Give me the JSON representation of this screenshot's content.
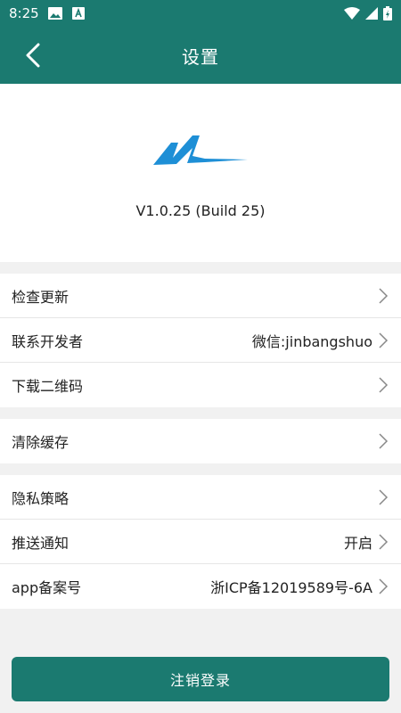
{
  "status_bar": {
    "time": "8:25"
  },
  "app_bar": {
    "title": "设置"
  },
  "about": {
    "version": "V1.0.25 (Build 25)"
  },
  "groups": [
    {
      "items": [
        {
          "label": "检查更新",
          "value": ""
        },
        {
          "label": "联系开发者",
          "value": "微信:jinbangshuo"
        },
        {
          "label": "下载二维码",
          "value": ""
        }
      ]
    },
    {
      "items": [
        {
          "label": "清除缓存",
          "value": ""
        }
      ]
    },
    {
      "items": [
        {
          "label": "隐私策略",
          "value": ""
        },
        {
          "label": "推送通知",
          "value": "开启"
        },
        {
          "label": "app备案号",
          "value": "浙ICP备12019589号-6A"
        }
      ]
    }
  ],
  "logout_label": "注销登录",
  "colors": {
    "primary": "#1b7a70",
    "logo_blue": "#1e8fd6",
    "background": "#f1f1f1"
  }
}
